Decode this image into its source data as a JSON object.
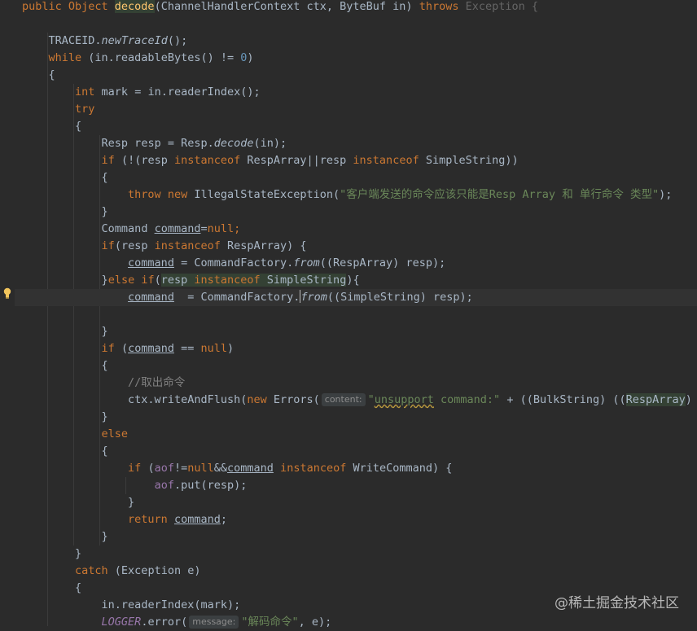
{
  "lines": [
    [
      "public Object ",
      "decode",
      "(ChannelHandlerContext ctx, ByteBuf in) ",
      "throws",
      " Exception {"
    ],
    [
      "TRACEID.",
      "newTraceId",
      "();"
    ],
    [
      "while",
      " (in.readableBytes() != ",
      "0",
      ")"
    ],
    [
      "{"
    ],
    [
      "int",
      " mark = in.readerIndex();"
    ],
    [
      "try"
    ],
    [
      "{"
    ],
    [
      "Resp resp = Resp.",
      "decode",
      "(in);"
    ],
    [
      "if",
      " (!(resp ",
      "instanceof",
      " RespArray||resp ",
      "instanceof",
      " SimpleString))"
    ],
    [
      "{"
    ],
    [
      "throw",
      " ",
      "new",
      " IllegalStateException(",
      "\"客户端发送的命令应该只能是Resp Array 和 单行命令 类型\"",
      ");"
    ],
    [
      "}"
    ],
    [
      "Command ",
      "command",
      "=",
      "null",
      ";"
    ],
    [
      "if",
      "(resp ",
      "instanceof",
      " RespArray) {"
    ],
    [
      "command",
      " = CommandFactory.",
      "from",
      "((RespArray) resp);"
    ],
    [
      "}",
      "else if",
      "(",
      "resp ",
      "instanceof",
      " SimpleString",
      "){"
    ],
    [
      "command",
      "  = CommandFactory.",
      "from",
      "((SimpleString) resp);"
    ],
    [
      "}"
    ],
    [
      "if",
      " (",
      "command",
      " == ",
      "null",
      ")"
    ],
    [
      "{"
    ],
    [
      "//取出命令"
    ],
    [
      "ctx.writeAndFlush(",
      "new",
      " Errors(",
      "content:",
      "\"",
      "unsupport",
      " command:\"",
      " + ((BulkString) ((",
      "RespArray",
      ") r"
    ],
    [
      "}"
    ],
    [
      "else"
    ],
    [
      "{"
    ],
    [
      "if",
      " (",
      "aof",
      "!=",
      "null",
      "&&",
      "command",
      " ",
      "instanceof",
      " WriteCommand) {"
    ],
    [
      "aof",
      ".put(resp);"
    ],
    [
      "}"
    ],
    [
      "return",
      " ",
      "command",
      ";"
    ],
    [
      "}"
    ],
    [
      "}"
    ],
    [
      "catch",
      " (Exception e)"
    ],
    [
      "{"
    ],
    [
      "in.readerIndex(mark);"
    ],
    [
      "LOGGER",
      ".error(",
      "message:",
      "\"解码命令\"",
      ", e);"
    ]
  ],
  "watermark": "@稀土掘金技术社区",
  "colors": {
    "background": "#2b2b2b",
    "keyword": "#cc7832",
    "string": "#6a8759",
    "method": "#ffc66d",
    "number": "#6897bb"
  }
}
